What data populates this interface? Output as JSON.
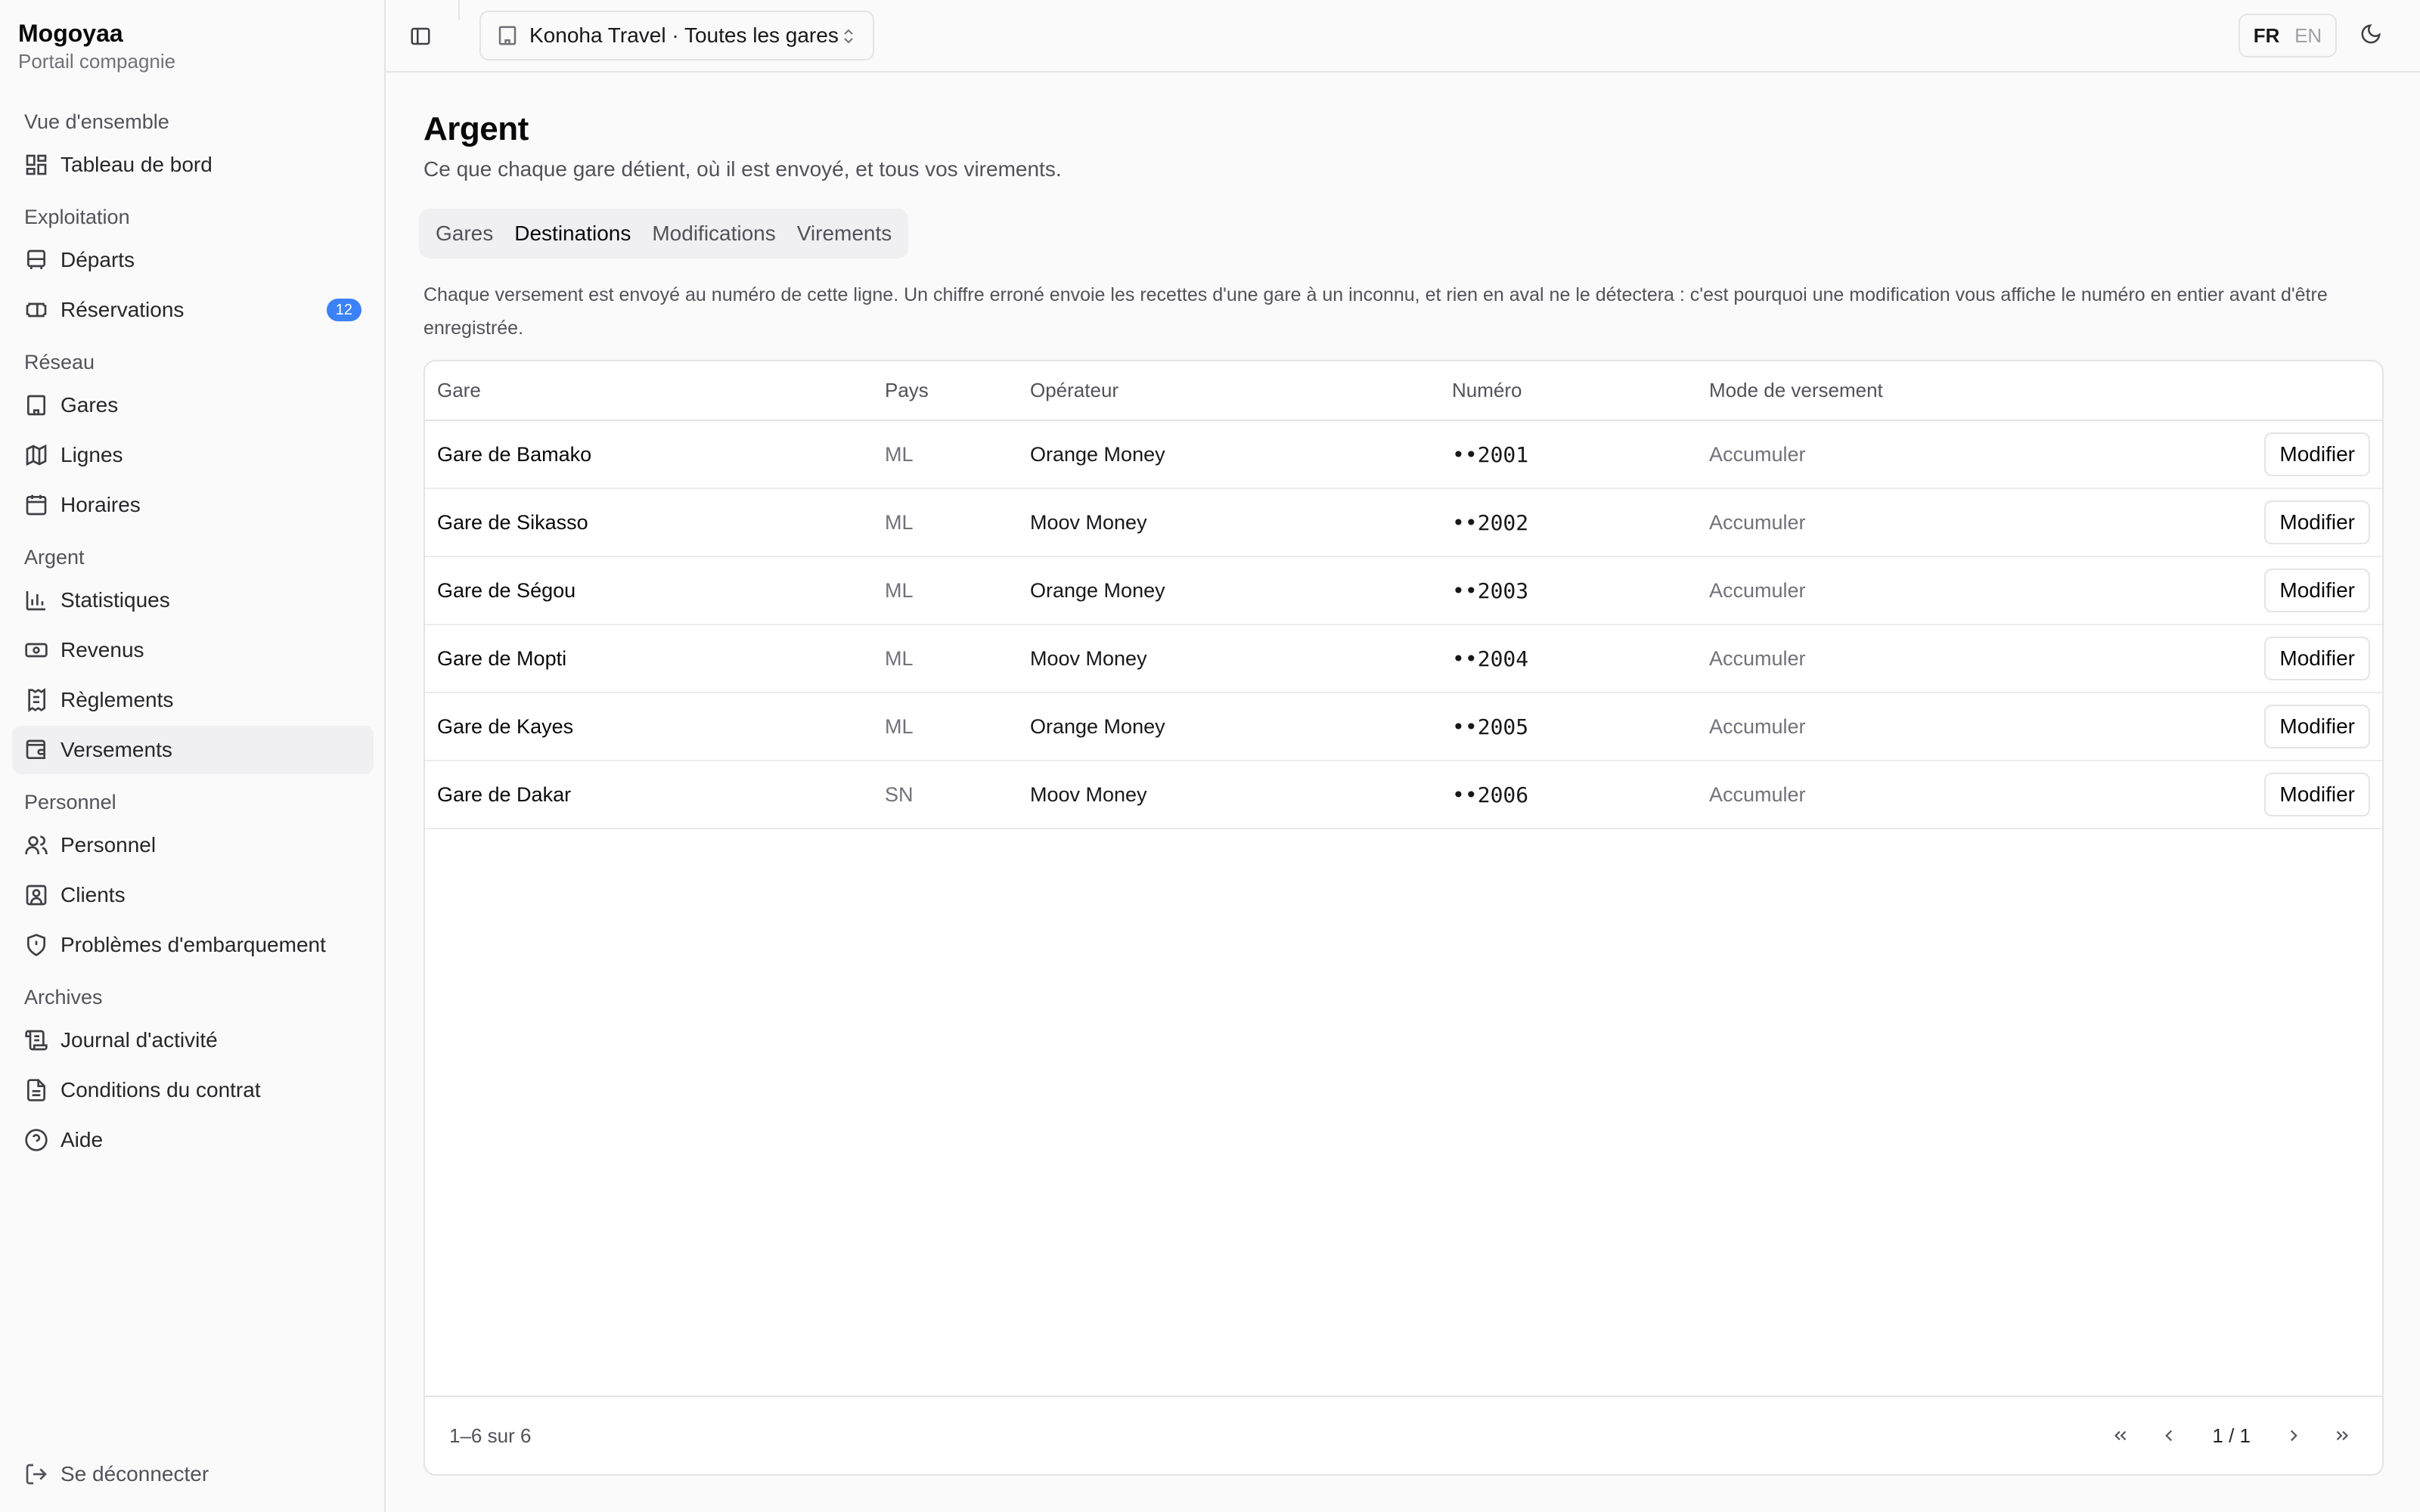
{
  "brand": {
    "name": "Mogoyaa",
    "subtitle": "Portail compagnie"
  },
  "sidebar": {
    "groups": [
      {
        "label": "Vue d'ensemble",
        "items": [
          {
            "label": "Tableau de bord",
            "icon": "dashboard-icon"
          }
        ]
      },
      {
        "label": "Exploitation",
        "items": [
          {
            "label": "Départs",
            "icon": "bus-icon"
          },
          {
            "label": "Réservations",
            "icon": "ticket-icon",
            "badge": "12"
          }
        ]
      },
      {
        "label": "Réseau",
        "items": [
          {
            "label": "Gares",
            "icon": "building-icon"
          },
          {
            "label": "Lignes",
            "icon": "map-icon"
          },
          {
            "label": "Horaires",
            "icon": "calendar-icon"
          }
        ]
      },
      {
        "label": "Argent",
        "items": [
          {
            "label": "Statistiques",
            "icon": "bar-chart-icon"
          },
          {
            "label": "Revenus",
            "icon": "banknote-icon"
          },
          {
            "label": "Règlements",
            "icon": "receipt-icon"
          },
          {
            "label": "Versements",
            "icon": "wallet-icon",
            "active": true
          }
        ]
      },
      {
        "label": "Personnel",
        "items": [
          {
            "label": "Personnel",
            "icon": "users-icon"
          },
          {
            "label": "Clients",
            "icon": "contact-icon"
          },
          {
            "label": "Problèmes d'embarquement",
            "icon": "shield-icon"
          }
        ]
      },
      {
        "label": "Archives",
        "items": [
          {
            "label": "Journal d'activité",
            "icon": "scroll-icon"
          },
          {
            "label": "Conditions du contrat",
            "icon": "document-icon"
          },
          {
            "label": "Aide",
            "icon": "help-icon"
          }
        ]
      }
    ],
    "logout": "Se déconnecter"
  },
  "topbar": {
    "company": "Konoha Travel · Toutes les gares",
    "lang_active": "FR",
    "lang_other": "EN"
  },
  "page": {
    "title": "Argent",
    "subtitle": "Ce que chaque gare détient, où il est envoyé, et tous vos virements.",
    "tabs": [
      "Gares",
      "Destinations",
      "Modifications",
      "Virements"
    ],
    "active_tab": "Destinations",
    "notice": "Chaque versement est envoyé au numéro de cette ligne. Un chiffre erroné envoie les recettes d'une gare à un inconnu, et rien en aval ne le détectera : c'est pourquoi une modification vous affiche le numéro en entier avant d'être enregistrée."
  },
  "table": {
    "headers": [
      "Gare",
      "Pays",
      "Opérateur",
      "Numéro",
      "Mode de versement"
    ],
    "action_label": "Modifier",
    "rows": [
      {
        "gare": "Gare de Bamako",
        "pays": "ML",
        "operateur": "Orange Money",
        "numero": "••2001",
        "mode": "Accumuler"
      },
      {
        "gare": "Gare de Sikasso",
        "pays": "ML",
        "operateur": "Moov Money",
        "numero": "••2002",
        "mode": "Accumuler"
      },
      {
        "gare": "Gare de Ségou",
        "pays": "ML",
        "operateur": "Orange Money",
        "numero": "••2003",
        "mode": "Accumuler"
      },
      {
        "gare": "Gare de Mopti",
        "pays": "ML",
        "operateur": "Moov Money",
        "numero": "••2004",
        "mode": "Accumuler"
      },
      {
        "gare": "Gare de Kayes",
        "pays": "ML",
        "operateur": "Orange Money",
        "numero": "••2005",
        "mode": "Accumuler"
      },
      {
        "gare": "Gare de Dakar",
        "pays": "SN",
        "operateur": "Moov Money",
        "numero": "••2006",
        "mode": "Accumuler"
      }
    ],
    "range": "1–6 sur 6",
    "page_info": "1 / 1"
  },
  "colors": {
    "accent": "#3b82f6",
    "text": "#18181b",
    "muted": "#71717a",
    "border": "#e4e4e7"
  }
}
